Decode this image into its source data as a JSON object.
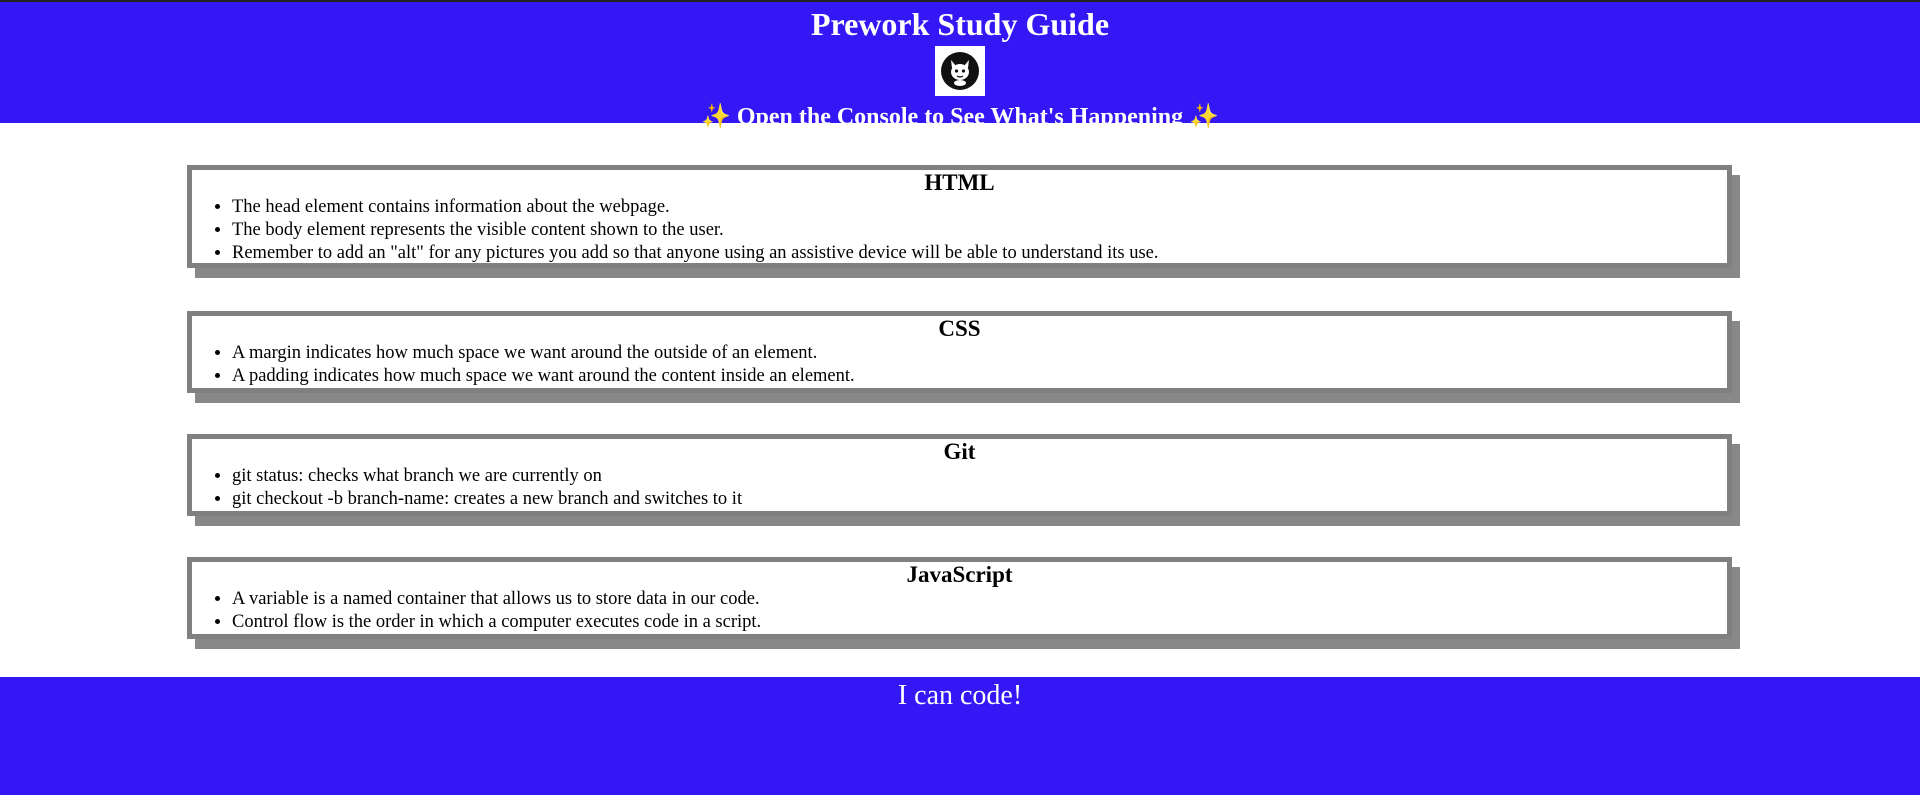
{
  "header": {
    "title": "Prework Study Guide",
    "logo_icon": "cat-avatar-icon",
    "subtitle_emoji_left": "✨",
    "subtitle": "Open the Console to See What's Happening",
    "subtitle_emoji_right": "✨"
  },
  "sections": [
    {
      "heading": "HTML",
      "items": [
        "The head element contains information about the webpage.",
        "The body element represents the visible content shown to the user.",
        "Remember to add an \"alt\" for any pictures you add so that anyone using an assistive device will be able to understand its use."
      ]
    },
    {
      "heading": "CSS",
      "items": [
        "A margin indicates how much space we want around the outside of an element.",
        "A padding indicates how much space we want around the content inside an element."
      ]
    },
    {
      "heading": "Git",
      "items": [
        "git status: checks what branch we are currently on",
        "git checkout -b branch-name: creates a new branch and switches to it"
      ]
    },
    {
      "heading": "JavaScript",
      "items": [
        "A variable is a named container that allows us to store data in our code.",
        "Control flow is the order in which a computer executes code in a script."
      ]
    }
  ],
  "footer": {
    "text": "I can code!"
  },
  "colors": {
    "brand_blue": "#3317f5",
    "card_border": "#808080",
    "sparkle": "#f6c343"
  }
}
